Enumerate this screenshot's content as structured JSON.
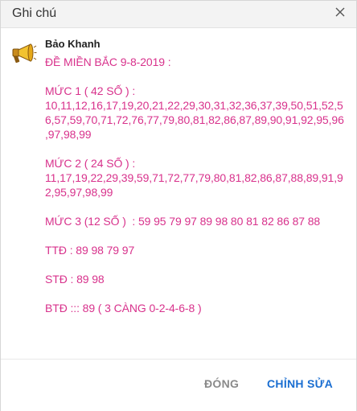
{
  "dialog": {
    "title": "Ghi chú",
    "close_icon": "close-icon"
  },
  "note": {
    "author": "Bảo Khanh",
    "avatar_icon": "megaphone-icon",
    "text": "ĐỀ MIỀN BẮC 9-8-2019 :\n\nMỨC 1 ( 42 SỐ ) :\n10,11,12,16,17,19,20,21,22,29,30,31,32,36,37,39,50,51,52,56,57,59,70,71,72,76,77,79,80,81,82,86,87,89,90,91,92,95,96,97,98,99\n\nMỨC 2 ( 24 SỐ ) :\n11,17,19,22,29,39,59,71,72,77,79,80,81,82,86,87,88,89,91,92,95,97,98,99\n\nMỨC 3 (12 SỐ )  : 59 95 79 97 89 98 80 81 82 86 87 88\n\nTTĐ : 89 98 79 97\n\nSTĐ : 89 98\n\nBTĐ ::: 89 ( 3 CÀNG 0-2-4-6-8 )",
    "text_color": "#d8328c"
  },
  "footer": {
    "close_label": "ĐÓNG",
    "edit_label": "CHỈNH SỬA",
    "accent_color": "#1a6ed1"
  }
}
